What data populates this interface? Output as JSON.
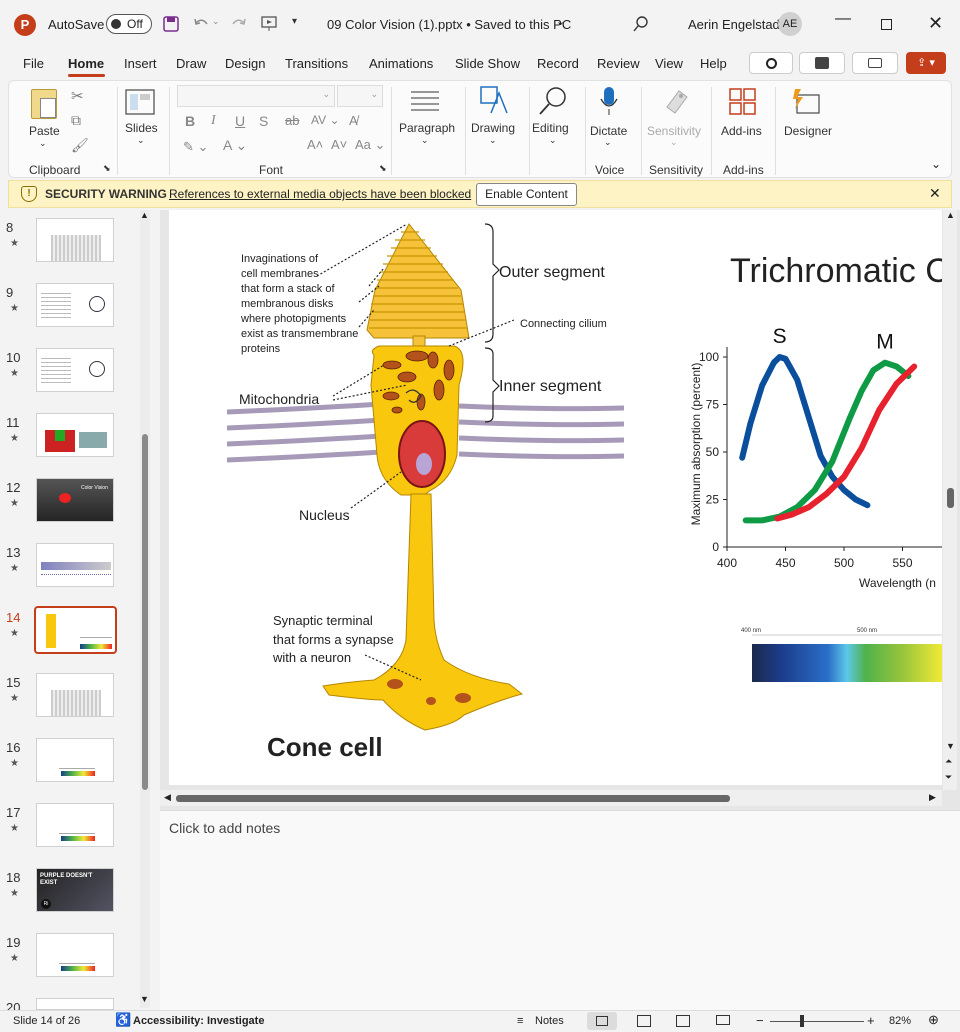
{
  "titlebar": {
    "autosave_label": "AutoSave",
    "autosave_state": "Off",
    "doc_title": "09 Color Vision (1).pptx • Saved to this PC",
    "user_name": "Aerin Engelstad",
    "user_initials": "AE"
  },
  "menu": [
    "File",
    "Home",
    "Insert",
    "Draw",
    "Design",
    "Transitions",
    "Animations",
    "Slide Show",
    "Record",
    "Review",
    "View",
    "Help"
  ],
  "ribbon": {
    "paste": "Paste",
    "slides": "Slides",
    "paragraph": "Paragraph",
    "drawing": "Drawing",
    "editing": "Editing",
    "dictate": "Dictate",
    "sensitivity": "Sensitivity",
    "addins": "Add-ins",
    "designer": "Designer",
    "groups": {
      "clipboard": "Clipboard",
      "font": "Font",
      "voice": "Voice",
      "sensitivity": "Sensitivity",
      "addins": "Add-ins"
    }
  },
  "warning": {
    "title": "SECURITY WARNING",
    "message": "References to external media objects have been blocked",
    "button": "Enable Content"
  },
  "thumbnails": [
    {
      "num": "8",
      "dark": false
    },
    {
      "num": "9",
      "dark": false
    },
    {
      "num": "10",
      "dark": false
    },
    {
      "num": "11",
      "dark": false
    },
    {
      "num": "12",
      "dark": true
    },
    {
      "num": "13",
      "dark": false
    },
    {
      "num": "14",
      "dark": false
    },
    {
      "num": "15",
      "dark": false
    },
    {
      "num": "16",
      "dark": false
    },
    {
      "num": "17",
      "dark": false
    },
    {
      "num": "18",
      "dark": true
    },
    {
      "num": "19",
      "dark": false
    },
    {
      "num": "20",
      "dark": false
    }
  ],
  "thumb_text": {
    "t12": "Color Vision",
    "t18a": "PURPLE DOESN'T",
    "t18b": "EXIST",
    "t18c": "Ri"
  },
  "slide": {
    "label_membranes": [
      "Invaginations of",
      "cell membranes",
      "that form a stack of",
      "membranous disks",
      "where photopigments",
      "exist as transmembrane",
      "proteins"
    ],
    "outer_segment": "Outer segment",
    "connecting_cilium": "Connecting cilium",
    "inner_segment": "Inner segment",
    "mitochondria": "Mitochondria",
    "nucleus": "Nucleus",
    "synaptic": [
      "Synaptic terminal",
      "that forms a synapse",
      "with a neuron"
    ],
    "cone_cell": "Cone cell",
    "chart_title": "Trichromatic C",
    "spectrum_400": "400 nm",
    "spectrum_500": "500 nm"
  },
  "chart_data": {
    "type": "line",
    "title": "Trichromatic C",
    "xlabel": "Wavelength (n",
    "ylabel": "Maximum absorption (percent)",
    "xlim": [
      400,
      560
    ],
    "ylim": [
      0,
      100
    ],
    "xticks": [
      "400",
      "450",
      "500",
      "550"
    ],
    "yticks": [
      "0",
      "25",
      "50",
      "75",
      "100"
    ],
    "series": [
      {
        "name": "S",
        "color": "#0b4f9c",
        "x": [
          413,
          420,
          430,
          440,
          445,
          450,
          460,
          470,
          480,
          490,
          500,
          510,
          520
        ],
        "y": [
          47,
          65,
          85,
          97,
          100,
          99,
          88,
          68,
          48,
          37,
          30,
          25,
          22
        ]
      },
      {
        "name": "M",
        "color": "#0f9a46",
        "x": [
          416,
          430,
          445,
          460,
          475,
          490,
          505,
          515,
          525,
          535,
          545,
          555
        ],
        "y": [
          14,
          14,
          16,
          21,
          30,
          45,
          68,
          82,
          93,
          97,
          95,
          90
        ]
      },
      {
        "name": "",
        "color": "#e8212e",
        "x": [
          443,
          455,
          470,
          485,
          500,
          515,
          530,
          545,
          560
        ],
        "y": [
          15,
          17,
          21,
          28,
          37,
          52,
          72,
          86,
          95
        ]
      }
    ]
  },
  "notes_placeholder": "Click to add notes",
  "status": {
    "slide_info": "Slide 14 of 26",
    "accessibility": "Accessibility: Investigate",
    "notes": "Notes",
    "zoom": "82%"
  }
}
